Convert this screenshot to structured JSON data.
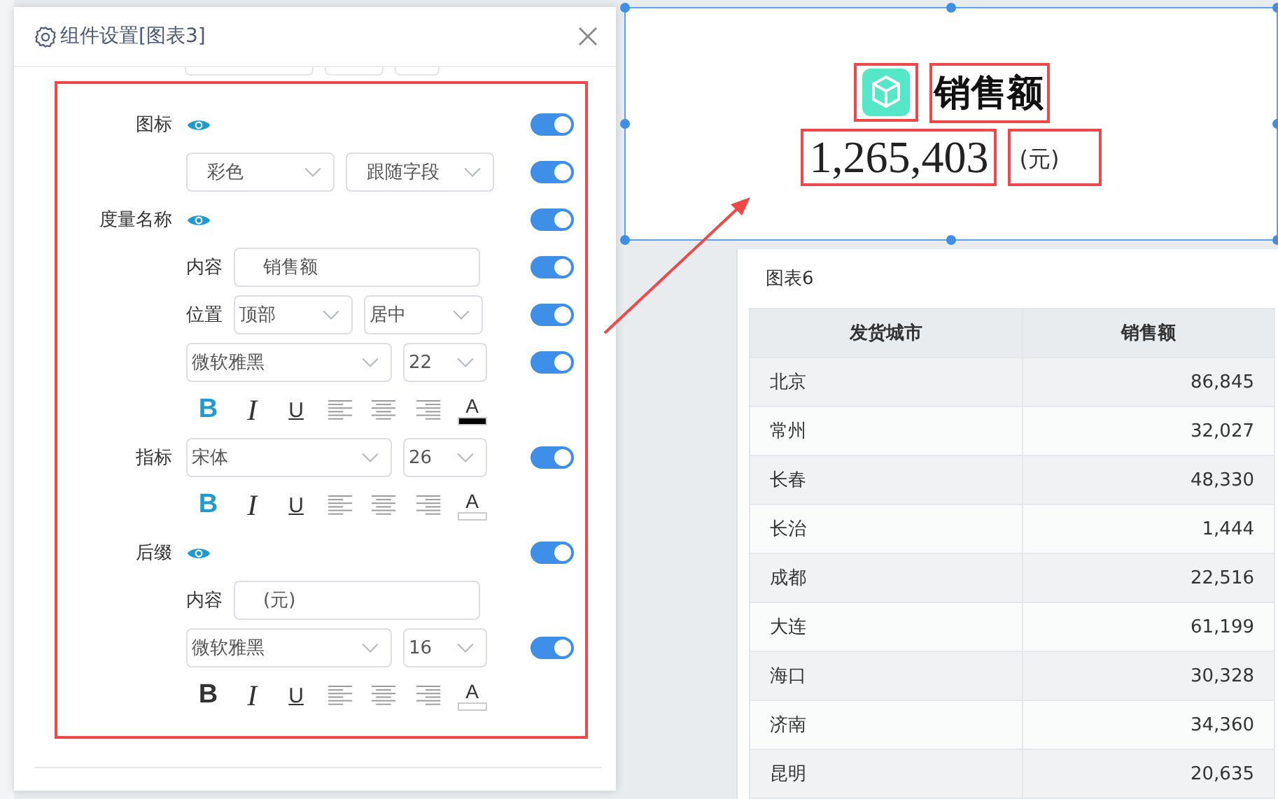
{
  "dialog": {
    "title": "组件设置[图表3]",
    "rows": [
      {
        "kind": "header",
        "label": "图标",
        "toggle": true
      },
      {
        "kind": "selects",
        "selects": [
          "彩色",
          "跟随字段"
        ],
        "toggle": true
      },
      {
        "kind": "header",
        "label": "度量名称",
        "toggle": true
      },
      {
        "kind": "input",
        "label": "内容",
        "value": "销售额",
        "toggle": true
      },
      {
        "kind": "selects",
        "label": "位置",
        "selects": [
          "顶部",
          "居中"
        ],
        "toggle": true
      },
      {
        "kind": "font",
        "selects": [
          "微软雅黑",
          "22"
        ],
        "toggle": true
      },
      {
        "kind": "toolbar",
        "bold": true,
        "italic": "I",
        "underline": "U",
        "bold_label": "B",
        "color_label": "A",
        "color": "#000000"
      },
      {
        "kind": "font",
        "label": "指标",
        "selects": [
          "宋体",
          "26"
        ],
        "toggle": true
      },
      {
        "kind": "toolbar",
        "bold": true,
        "italic": "I",
        "underline": "U",
        "bold_label": "B",
        "color_label": "A",
        "color": "#ffffff"
      },
      {
        "kind": "header",
        "label": "后缀",
        "toggle": true
      },
      {
        "kind": "input",
        "label": "内容",
        "value": "(元)"
      },
      {
        "kind": "font",
        "selects": [
          "微软雅黑",
          "16"
        ],
        "toggle": true
      },
      {
        "kind": "toolbar",
        "bold": false,
        "italic": "I",
        "underline": "U",
        "bold_label": "B",
        "color_label": "A",
        "color": "#ffffff"
      }
    ]
  },
  "kpi_card": {
    "title": "销售额",
    "value": "1,265,403",
    "suffix": "(元)"
  },
  "table_panel": {
    "title": "图表6",
    "columns": [
      "发货城市",
      "销售额"
    ],
    "rows": [
      [
        "北京",
        "86,845"
      ],
      [
        "常州",
        "32,027"
      ],
      [
        "长春",
        "48,330"
      ],
      [
        "长治",
        "1,444"
      ],
      [
        "成都",
        "22,516"
      ],
      [
        "大连",
        "61,199"
      ],
      [
        "海口",
        "30,328"
      ],
      [
        "济南",
        "34,360"
      ],
      [
        "昆明",
        "20,635"
      ]
    ]
  }
}
